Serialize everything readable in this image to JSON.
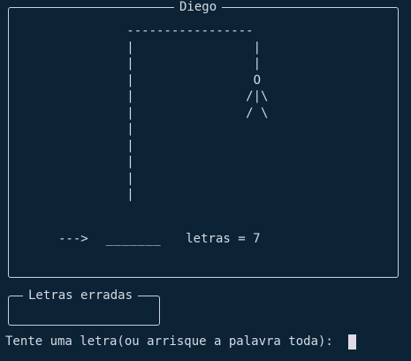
{
  "game": {
    "player_name": "Diego",
    "hangman_art": "   -----------------\n   |                |\n   |                |\n   |                O\n   |               /|\\\n   |               / \\\n   |\n   |\n   |\n   |\n   |",
    "arrow": "--->",
    "masked_word": "_______",
    "letters_label": "letras = 7"
  },
  "wrong_letters": {
    "title": "Letras erradas",
    "value": ""
  },
  "prompt": {
    "text": "Tente uma letra(ou arrisque a palavra toda): "
  },
  "colors": {
    "background": "#0c2336",
    "foreground": "#d4dbe2",
    "cursor": "#e0dbe4"
  }
}
